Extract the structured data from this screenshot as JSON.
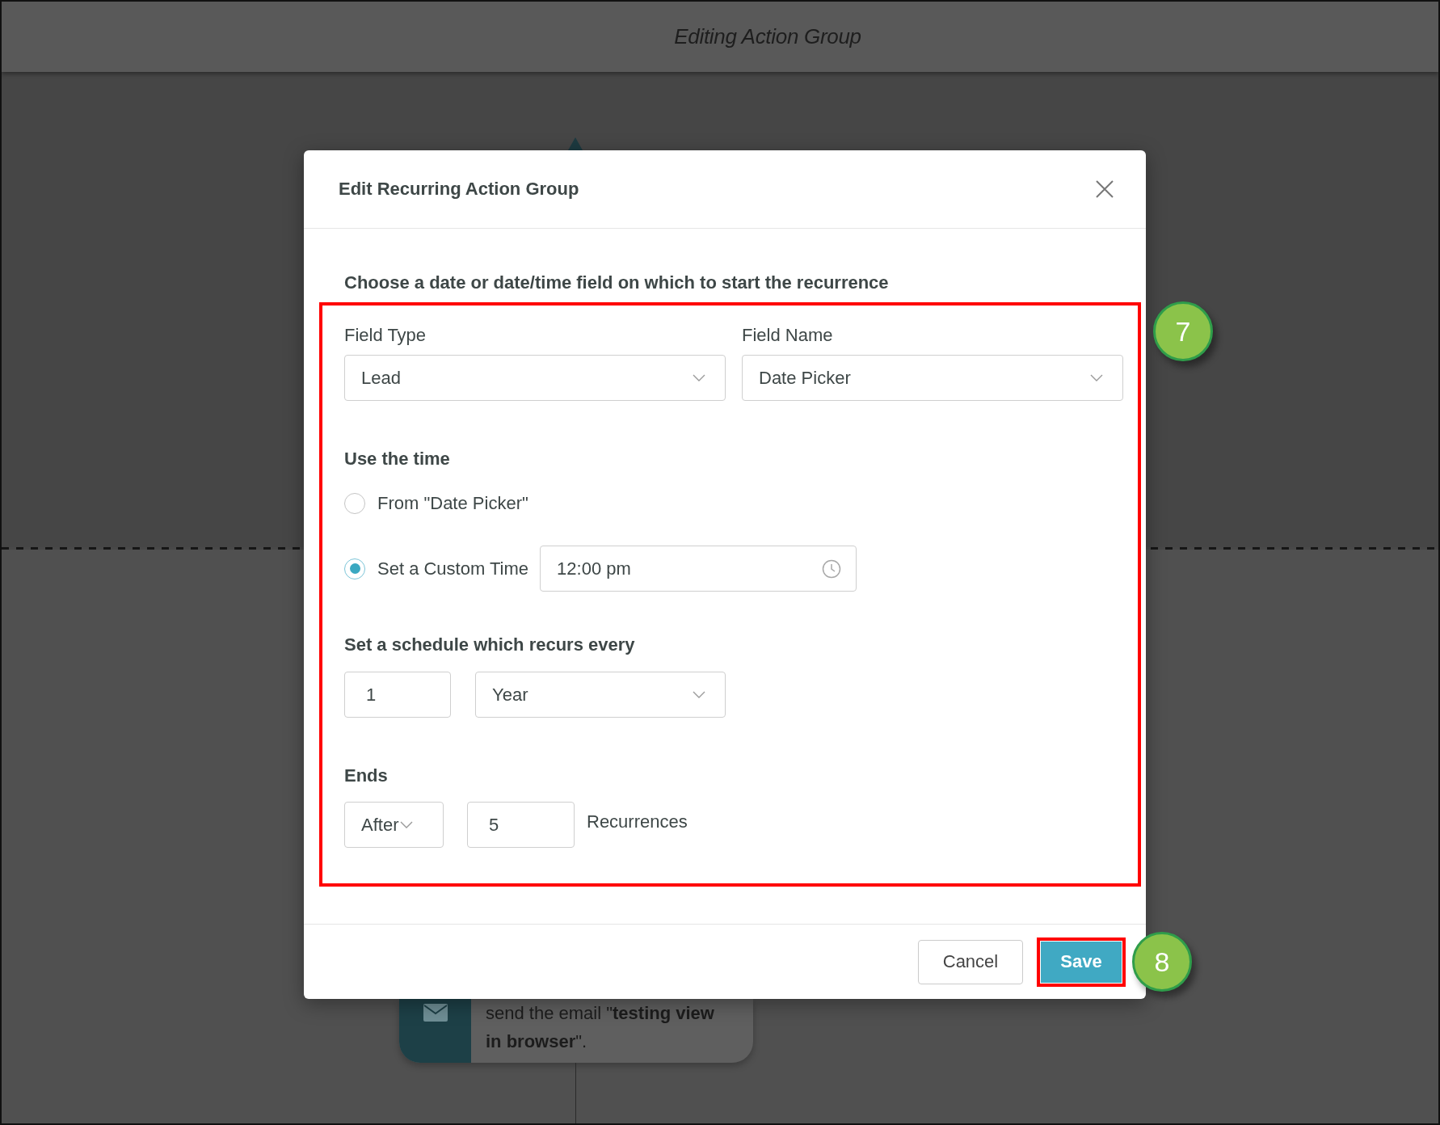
{
  "page": {
    "title": "Editing Action Group"
  },
  "background_card": {
    "text": "send the email \"**testing view in browser**\"."
  },
  "dialog": {
    "title": "Edit Recurring Action Group",
    "heading": "Choose a date or date/time field on which to start the recurrence",
    "form_highlighted": true,
    "start_fields": [
      {
        "label": "Field Type",
        "value": "Lead"
      },
      {
        "label": "Field Name",
        "value": "Date Picker"
      }
    ],
    "time_heading": "Use the time",
    "time_options": [
      {
        "kind": "plain",
        "label": "From \"Date Picker\"",
        "selected": false
      },
      {
        "kind": "custom_time",
        "label": "Set a Custom Time",
        "selected": true,
        "value": "12:00 pm"
      }
    ],
    "schedule": {
      "heading": "Set a schedule which recurs every",
      "interval": "1",
      "unit": "Year"
    },
    "ends": {
      "heading": "Ends",
      "mode": "After",
      "count": "5",
      "suffix": "Recurrences"
    },
    "buttons": [
      {
        "kind": "secondary",
        "label": "Cancel",
        "highlighted": false
      },
      {
        "kind": "primary",
        "label": "Save",
        "highlighted": true
      }
    ]
  },
  "callouts": [
    {
      "label": "7"
    },
    {
      "label": "8"
    }
  ]
}
